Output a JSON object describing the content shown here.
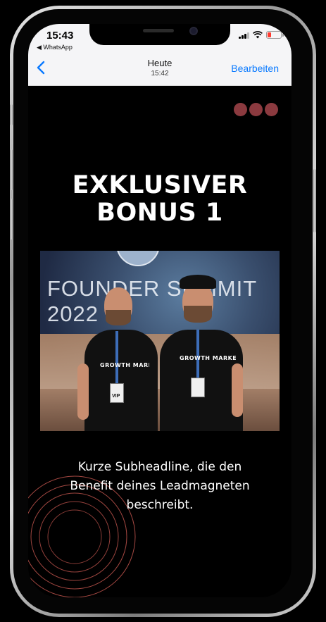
{
  "statusbar": {
    "time": "15:43",
    "back_app": "◀ WhatsApp"
  },
  "nav": {
    "back_icon": "chevron-left-icon",
    "title": "Heute",
    "subtitle": "15:42",
    "edit_label": "Bearbeiten"
  },
  "content": {
    "headline_line1": "EXKLUSIVER",
    "headline_line2": "BONUS 1",
    "photo": {
      "backdrop_text": "FOUNDER SUMMIT 2022",
      "shirt_text": "GROWTH MARKETER",
      "badge_text": "VIP"
    },
    "subheadline": "Kurze Subheadline, die den Benefit deines Leadmagneten beschreibt."
  },
  "colors": {
    "accent_dots": "#8b3a3f",
    "ring_stroke": "#c4564f",
    "ios_blue": "#0a7aff",
    "background": "#000000"
  }
}
